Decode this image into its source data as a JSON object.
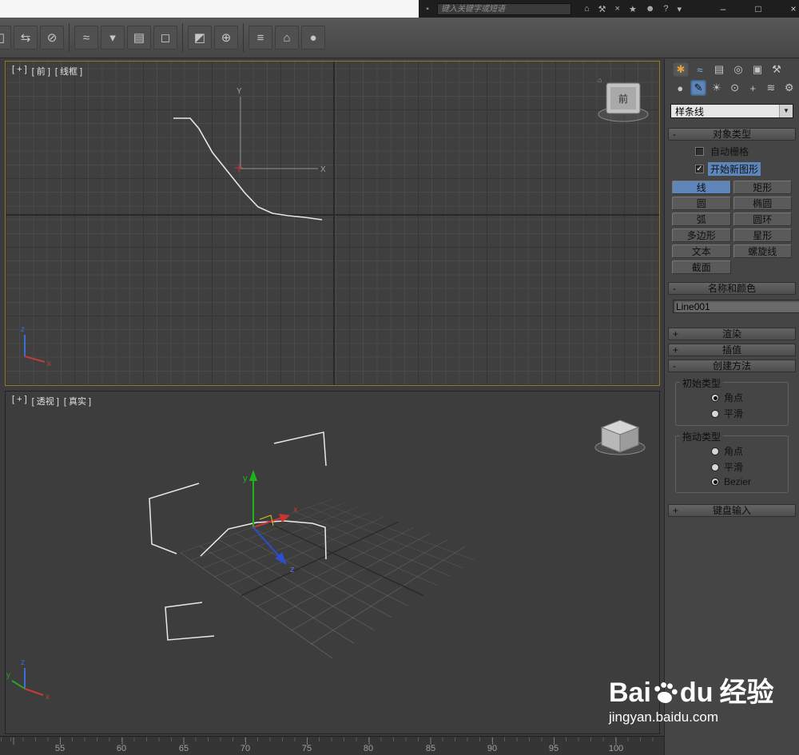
{
  "titlebar": {
    "search_placeholder": "键入关键字或短语",
    "minimize": "–",
    "maximize": "□",
    "close": "×"
  },
  "viewports": {
    "front": {
      "menu": [
        "[ + ]",
        "[ 前 ]",
        "[ 线框 ]"
      ],
      "viewcube_face": "前",
      "gizmo_x": "X",
      "gizmo_y": "Y",
      "axis_x": "x",
      "axis_z": "z"
    },
    "persp": {
      "menu": [
        "[ + ]",
        "[ 透视 ]",
        "[ 真实 ]"
      ],
      "axis_x": "x",
      "axis_y": "y",
      "axis_z": "z"
    }
  },
  "panel": {
    "category_select": "样条线",
    "select_arrow": "▼",
    "check_glyph": "✓",
    "rollouts": {
      "object_type": {
        "sign": "-",
        "title": "对象类型"
      },
      "name_color": {
        "sign": "-",
        "title": "名称和颜色"
      },
      "rendering": {
        "sign": "+",
        "title": "渲染"
      },
      "interpolation": {
        "sign": "+",
        "title": "插值"
      },
      "creation_method": {
        "sign": "-",
        "title": "创建方法"
      },
      "keyboard_entry": {
        "sign": "+",
        "title": "键盘输入"
      }
    },
    "checkbox_autogrid": "自动栅格",
    "checkbox_start_new_shape": "开始新图形",
    "buttons": {
      "line": "线",
      "rectangle": "矩形",
      "circle": "圆",
      "ellipse": "椭圆",
      "arc": "弧",
      "donut": "圆环",
      "ngon": "多边形",
      "star": "星形",
      "text": "文本",
      "helix": "螺旋线",
      "section": "截面"
    },
    "name_value": "Line001",
    "groups": {
      "initial": {
        "title": "初始类型",
        "corner": "角点",
        "smooth": "平滑"
      },
      "drag": {
        "title": "拖动类型",
        "corner": "角点",
        "smooth": "平滑",
        "bezier": "Bezier"
      }
    }
  },
  "timeline": {
    "labels": [
      "55",
      "60",
      "65",
      "70",
      "75",
      "80",
      "85",
      "90",
      "95",
      "100"
    ]
  },
  "watermark": {
    "part1": "Bai",
    "part2": "du",
    "suffix": "经验",
    "url": "jingyan.baidu.com"
  },
  "colors": {
    "selected_blue": "#5e86ba",
    "name_swatch": "#d9a3dc",
    "viewport_active_border": "#8e7b2f"
  }
}
